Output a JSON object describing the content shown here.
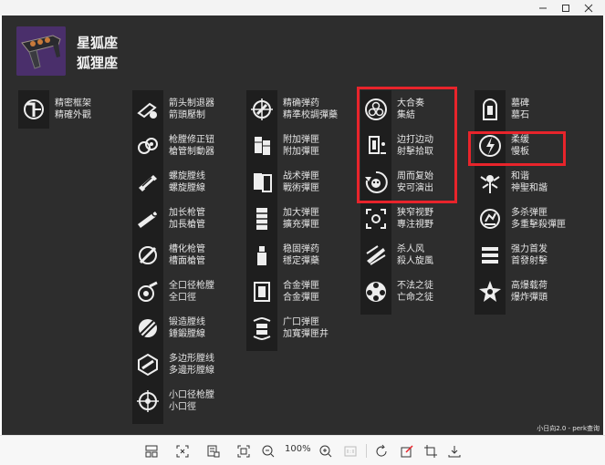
{
  "window": {
    "min_icon": "minimize-icon",
    "max_icon": "maximize-icon",
    "close_icon": "close-icon"
  },
  "weapon": {
    "name_simplified": "星狐座",
    "name_traditional": "狐狸座"
  },
  "columns": [
    {
      "perks": [
        {
          "icon": "frame-icon",
          "t1": "精密框架",
          "t2": "精確外觀"
        }
      ]
    },
    {
      "perks": [
        {
          "icon": "arrowhead-brake-icon",
          "t1": "箭头制退器",
          "t2": "箭頭壓制"
        },
        {
          "icon": "muzzle-brake-icon",
          "t1": "枪膛修正钮",
          "t2": "槍管制動器"
        },
        {
          "icon": "fluted-barrel-icon",
          "t1": "螺旋膛线",
          "t2": "螺旋膛線"
        },
        {
          "icon": "extended-barrel-icon",
          "t1": "加长枪管",
          "t2": "加長槍管"
        },
        {
          "icon": "chambered-compensator-icon",
          "t1": "槽化枪管",
          "t2": "槽面槍管"
        },
        {
          "icon": "full-bore-icon",
          "t1": "全口径枪膛",
          "t2": "全口徑"
        },
        {
          "icon": "hammer-forged-icon",
          "t1": "锻造膛线",
          "t2": "錘鍛膛線"
        },
        {
          "icon": "polygonal-rifling-icon",
          "t1": "多边形膛线",
          "t2": "多邊形膛線"
        },
        {
          "icon": "smallbore-icon",
          "t1": "小口径枪膛",
          "t2": "小口徑"
        }
      ]
    },
    {
      "perks": [
        {
          "icon": "accurized-rounds-icon",
          "t1": "精确弹药",
          "t2": "精準校調彈藥"
        },
        {
          "icon": "appended-mag-icon",
          "t1": "附加弹匣",
          "t2": "附加彈匣"
        },
        {
          "icon": "tactical-mag-icon",
          "t1": "战术弹匣",
          "t2": "戰術彈匣"
        },
        {
          "icon": "extended-mag-icon",
          "t1": "加大弹匣",
          "t2": "擴充彈匣"
        },
        {
          "icon": "steady-rounds-icon",
          "t1": "稳固弹药",
          "t2": "穩定彈藥"
        },
        {
          "icon": "alloy-mag-icon",
          "t1": "合金弹匣",
          "t2": "合金彈匣"
        },
        {
          "icon": "flared-magwell-icon",
          "t1": "广口弹匣",
          "t2": "加寬彈匣井"
        }
      ]
    },
    {
      "perks": [
        {
          "icon": "ensemble-icon",
          "t1": "大合奏",
          "t2": "集結"
        },
        {
          "icon": "hit-and-run-icon",
          "t1": "边打边动",
          "t2": "射擊拾取"
        },
        {
          "icon": "encore-icon",
          "t1": "周而复始",
          "t2": "安可演出"
        },
        {
          "icon": "narrow-sight-icon",
          "t1": "狭窄视野",
          "t2": "專注視野"
        },
        {
          "icon": "killing-wind-icon",
          "t1": "杀人风",
          "t2": "殺人旋風"
        },
        {
          "icon": "outlaw-icon",
          "t1": "不法之徒",
          "t2": "亡命之徒"
        }
      ]
    },
    {
      "perks": [
        {
          "icon": "headstone-icon",
          "t1": "墓碑",
          "t2": "墓石"
        },
        {
          "icon": "tempered-icon",
          "t1": "柔缓",
          "t2": "慢板"
        },
        {
          "icon": "harmony-icon",
          "t1": "和谐",
          "t2": "神聖和諧"
        },
        {
          "icon": "multikill-clip-icon",
          "t1": "多杀弹匣",
          "t2": "多重擊殺彈匣"
        },
        {
          "icon": "opening-shot-icon",
          "t1": "强力首发",
          "t2": "首發射擊"
        },
        {
          "icon": "explosive-payload-icon",
          "t1": "高爆载荷",
          "t2": "爆炸彈頭"
        }
      ]
    }
  ],
  "watermark": "小日向2.0 - perk查询",
  "toolbar": {
    "zoom": "100%",
    "icons": [
      "thumbnails-icon",
      "fit-screen-icon",
      "ocr-icon",
      "crop-frame-icon",
      "zoom-out-icon",
      "zoom-in-icon",
      "actual-size-icon",
      "rotate-icon",
      "edit-icon",
      "crop-icon",
      "download-icon"
    ]
  },
  "colors": {
    "canvas": "#2d2d2d",
    "column": "#1e1e1e",
    "highlight": "#e8242b",
    "text": "#e6e6e6"
  }
}
